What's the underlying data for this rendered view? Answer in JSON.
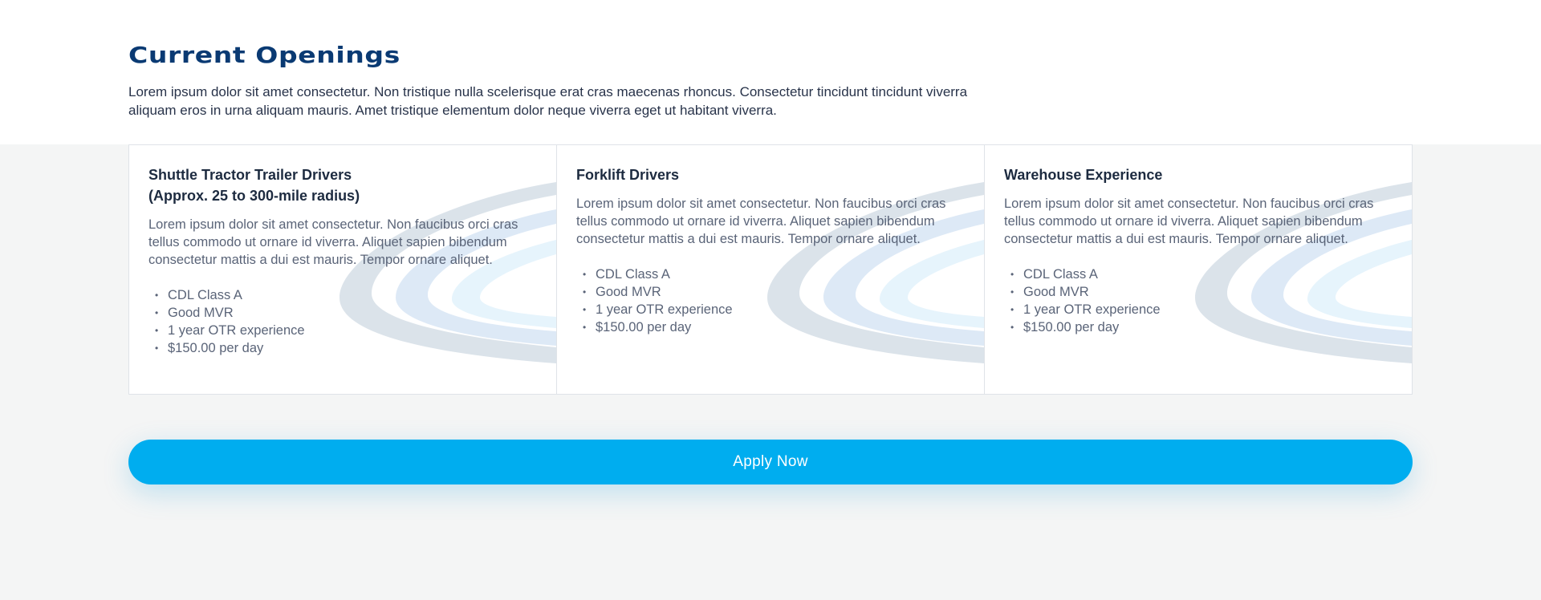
{
  "section": {
    "title": "Current Openings",
    "intro": "Lorem ipsum dolor sit amet consectetur. Non tristique nulla scelerisque erat cras maecenas rhoncus. Consectetur tincidunt tincidunt viverra aliquam eros in urna aliquam mauris. Amet tristique elementum dolor neque viverra eget ut habitant viverra."
  },
  "jobs": [
    {
      "title": "Shuttle Tractor Trailer Drivers\n(Approx. 25 to 300-mile radius)",
      "description": "Lorem ipsum dolor sit amet consectetur. Non faucibus orci cras tellus commodo ut ornare id viverra. Aliquet sapien bibendum consectetur mattis a dui est mauris. Tempor ornare aliquet.",
      "requirements": [
        "CDL Class A",
        "Good MVR",
        "1 year OTR experience",
        "$150.00 per day"
      ]
    },
    {
      "title": "Forklift Drivers",
      "description": "Lorem ipsum dolor sit amet consectetur. Non faucibus orci cras tellus commodo ut ornare id viverra. Aliquet sapien bibendum consectetur mattis a dui est mauris. Tempor ornare aliquet.",
      "requirements": [
        "CDL Class A",
        "Good MVR",
        "1 year OTR experience",
        "$150.00 per day"
      ]
    },
    {
      "title": "Warehouse Experience",
      "description": "Lorem ipsum dolor sit amet consectetur. Non faucibus orci cras tellus commodo ut ornare id viverra. Aliquet sapien bibendum consectetur mattis a dui est mauris. Tempor ornare aliquet.",
      "requirements": [
        "CDL Class A",
        "Good MVR",
        "1 year OTR experience",
        "$150.00 per day"
      ]
    }
  ],
  "cta": {
    "label": "Apply Now"
  },
  "colors": {
    "heading": "#0a3a73",
    "accent": "#00adef",
    "background": "#f4f5f5"
  }
}
